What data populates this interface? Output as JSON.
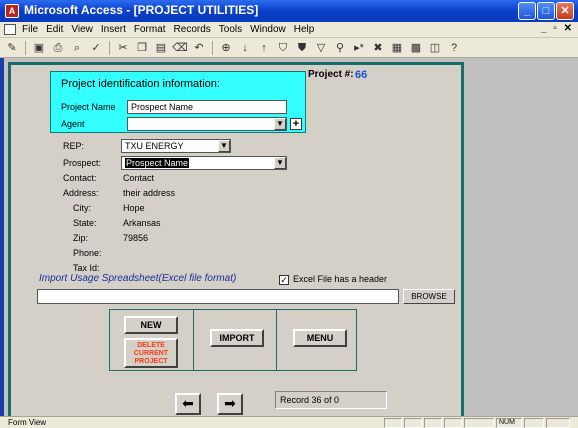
{
  "window": {
    "title": "Microsoft Access - [PROJECT UTILITIES]",
    "minimize": "_",
    "maximize": "□",
    "close": "✕"
  },
  "menu": {
    "items": [
      "File",
      "Edit",
      "View",
      "Insert",
      "Format",
      "Records",
      "Tools",
      "Window",
      "Help"
    ],
    "mdi_controls": "_ ▫ ✕"
  },
  "toolbar": {
    "icons": [
      "view",
      "save",
      "print",
      "print-preview",
      "spelling",
      "cut",
      "copy",
      "paste",
      "format-painter",
      "undo",
      "hyperlink",
      "sort-asc",
      "sort-desc",
      "filter-by-selection",
      "filter-by-form",
      "apply-filter",
      "find",
      "new-record",
      "delete-record",
      "properties",
      "database-window",
      "new-object",
      "help"
    ]
  },
  "project": {
    "id_heading": "Project identification information:",
    "name_label": "Project Name",
    "name_value": "Prospect Name",
    "agent_label": "Agent",
    "agent_value": "",
    "number_label": "Project #:",
    "number_value": "66"
  },
  "details": {
    "rep_label": "REP:",
    "rep_value": "TXU ENERGY",
    "prospect_label": "Prospect:",
    "prospect_value": "Prospect Name",
    "contact_label": "Contact:",
    "contact_value": "Contact",
    "address_label": "Address:",
    "address_value": "their address",
    "city_label": "City:",
    "city_value": "Hope",
    "state_label": "State:",
    "state_value": "Arkansas",
    "zip_label": "Zip:",
    "zip_value": "79856",
    "phone_label": "Phone:",
    "phone_value": "",
    "taxid_label": "Tax Id:",
    "taxid_value": ""
  },
  "import": {
    "label": "Import Usage Spreadsheet(Excel file format)",
    "header_checkbox_label": "Excel File has a header",
    "header_checked": true,
    "file_path": "",
    "browse_label": "BROWSE"
  },
  "buttons": {
    "new": "NEW",
    "delete_line1": "DELETE",
    "delete_line2": "CURRENT",
    "delete_line3": "PROJECT",
    "import": "IMPORT",
    "menu": "MENU"
  },
  "navigation": {
    "prev_glyph": "⬅",
    "next_glyph": "➡",
    "record_text": "Record 36 of 0"
  },
  "status": {
    "text": "Form View",
    "num_indicator": "NUM"
  },
  "colors": {
    "title_blue": "#0a3fc9",
    "cyan_panel": "#33ffff",
    "frame_teal": "#1e6b6b",
    "import_label": "#1a2f9c",
    "delete_text": "#ff3a14",
    "project_number": "#1a4fd8"
  }
}
